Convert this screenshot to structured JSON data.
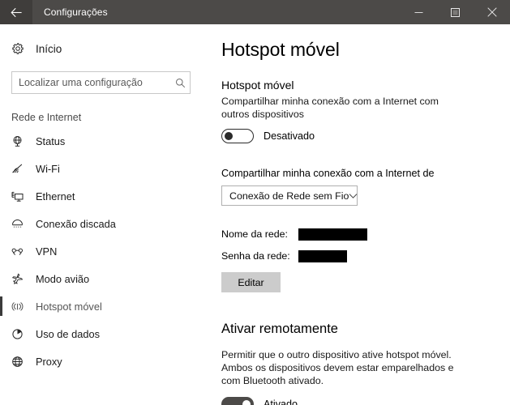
{
  "window": {
    "title": "Configurações",
    "back_icon": "back-arrow-icon",
    "minimize_icon": "minimize-icon",
    "maximize_icon": "maximize-icon",
    "close_icon": "close-icon"
  },
  "sidebar": {
    "home": {
      "label": "Início",
      "icon": "gear-icon"
    },
    "search": {
      "placeholder": "Localizar uma configuração",
      "value": "",
      "icon": "search-icon"
    },
    "section_header": "Rede e Internet",
    "items": [
      {
        "label": "Status",
        "icon": "status-globe-icon",
        "selected": false
      },
      {
        "label": "Wi-Fi",
        "icon": "wifi-icon",
        "selected": false
      },
      {
        "label": "Ethernet",
        "icon": "ethernet-icon",
        "selected": false
      },
      {
        "label": "Conexão discada",
        "icon": "dialup-icon",
        "selected": false
      },
      {
        "label": "VPN",
        "icon": "vpn-icon",
        "selected": false
      },
      {
        "label": "Modo avião",
        "icon": "airplane-icon",
        "selected": false
      },
      {
        "label": "Hotspot móvel",
        "icon": "hotspot-icon",
        "selected": true
      },
      {
        "label": "Uso de dados",
        "icon": "data-usage-pie-icon",
        "selected": false
      },
      {
        "label": "Proxy",
        "icon": "proxy-globe-icon",
        "selected": false
      }
    ]
  },
  "main": {
    "page_title": "Hotspot móvel",
    "section1": {
      "heading": "Hotspot móvel",
      "description": "Compartilhar minha conexão com a Internet com outros dispositivos",
      "toggle": {
        "state": "off",
        "label": "Desativado"
      },
      "share_from_label": "Compartilhar minha conexão com a Internet de",
      "share_from_select": {
        "value": "Conexão de Rede sem Fio",
        "chevron_icon": "chevron-down-icon"
      },
      "network_name_label": "Nome da rede:",
      "network_name_value": "",
      "network_password_label": "Senha da rede:",
      "network_password_value": "",
      "edit_button": "Editar"
    },
    "section2": {
      "heading": "Ativar remotamente",
      "description": "Permitir que o outro dispositivo ative hotspot móvel. Ambos os dispositivos devem estar emparelhados e com Bluetooth ativado.",
      "toggle": {
        "state": "on",
        "label": "Ativado"
      }
    }
  },
  "colors": {
    "titlebar": "#4c4a48",
    "accent_selected": "#3b3b3b",
    "button_face": "#cccccc",
    "redaction": "#000000"
  }
}
